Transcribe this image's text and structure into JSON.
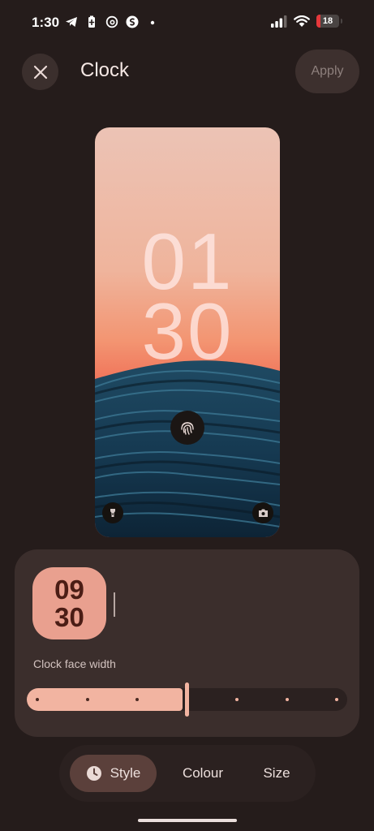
{
  "status_bar": {
    "time": "1:30",
    "left_icons": [
      "telegram-icon",
      "battery-saver-icon",
      "threads-icon",
      "shazam-icon",
      "dot-icon"
    ],
    "right_icons": [
      "signal-icon",
      "wifi-icon"
    ],
    "battery_level": "18",
    "battery_fraction": 0.18,
    "battery_color": "#e5383b"
  },
  "header": {
    "close_icon": "close-icon",
    "title": "Clock",
    "apply_label": "Apply"
  },
  "preview": {
    "hour": "01",
    "minute": "30",
    "fingerprint_icon": "fingerprint-icon",
    "left_shortcut_icon": "flashlight-icon",
    "right_shortcut_icon": "camera-icon"
  },
  "clock_panel": {
    "thumb_hour": "09",
    "thumb_minute": "30",
    "label": "Clock face width",
    "slider_value_fraction": 0.5,
    "slider_steps": 7,
    "accent": "#f2b4a1"
  },
  "tabs": [
    {
      "label": "Style",
      "icon": "clock-icon",
      "selected": true
    },
    {
      "label": "Colour",
      "selected": false
    },
    {
      "label": "Size",
      "selected": false
    }
  ]
}
